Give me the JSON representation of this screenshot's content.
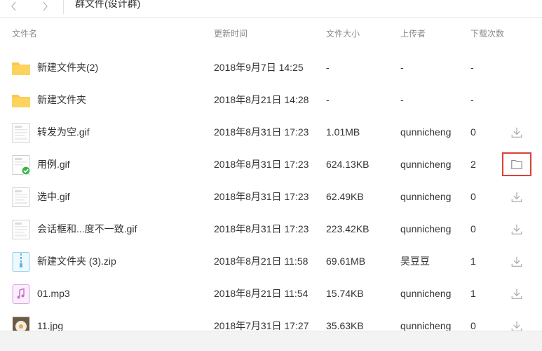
{
  "window": {
    "title": "群文件(设计群)",
    "back_icon": "chevron-left-icon",
    "forward_icon": "chevron-right-icon"
  },
  "columns": {
    "name": "文件名",
    "time": "更新时间",
    "size": "文件大小",
    "uploader": "上传者",
    "downloads": "下载次数"
  },
  "files": [
    {
      "name": "新建文件夹(2)",
      "time": "2018年9月7日 14:25",
      "size": "-",
      "uploader": "-",
      "downloads": "-",
      "icon": "folder-icon",
      "action": ""
    },
    {
      "name": "新建文件夹",
      "time": "2018年8月21日 14:28",
      "size": "-",
      "uploader": "-",
      "downloads": "-",
      "icon": "folder-icon",
      "action": ""
    },
    {
      "name": "转发为空.gif",
      "time": "2018年8月31日 17:23",
      "size": "1.01MB",
      "uploader": "qunnicheng",
      "downloads": "0",
      "icon": "image-thumbnail-icon",
      "action": "download-icon"
    },
    {
      "name": "用例.gif",
      "time": "2018年8月31日 17:23",
      "size": "624.13KB",
      "uploader": "qunnicheng",
      "downloads": "2",
      "icon": "image-thumbnail-downloaded-icon",
      "action": "open-folder-icon"
    },
    {
      "name": "选中.gif",
      "time": "2018年8月31日 17:23",
      "size": "62.49KB",
      "uploader": "qunnicheng",
      "downloads": "0",
      "icon": "image-thumbnail-icon",
      "action": "download-icon"
    },
    {
      "name": "会话框和...度不一致.gif",
      "time": "2018年8月31日 17:23",
      "size": "223.42KB",
      "uploader": "qunnicheng",
      "downloads": "0",
      "icon": "image-thumbnail-icon",
      "action": "download-icon"
    },
    {
      "name": "新建文件夹 (3).zip",
      "time": "2018年8月21日 11:58",
      "size": "69.61MB",
      "uploader": "吴豆豆",
      "downloads": "1",
      "icon": "zip-file-icon",
      "action": "download-icon"
    },
    {
      "name": "01.mp3",
      "time": "2018年8月21日 11:54",
      "size": "15.74KB",
      "uploader": "qunnicheng",
      "downloads": "1",
      "icon": "audio-file-icon",
      "action": "download-icon"
    },
    {
      "name": "11.jpg",
      "time": "2018年7月31日 17:27",
      "size": "35.63KB",
      "uploader": "qunnicheng",
      "downloads": "0",
      "icon": "photo-thumbnail-icon",
      "action": "download-icon"
    }
  ],
  "colors": {
    "folder": "#f9c94a",
    "highlight_border": "#d9423a",
    "check_badge": "#3cb44b",
    "header_text": "#8a8a8a"
  }
}
